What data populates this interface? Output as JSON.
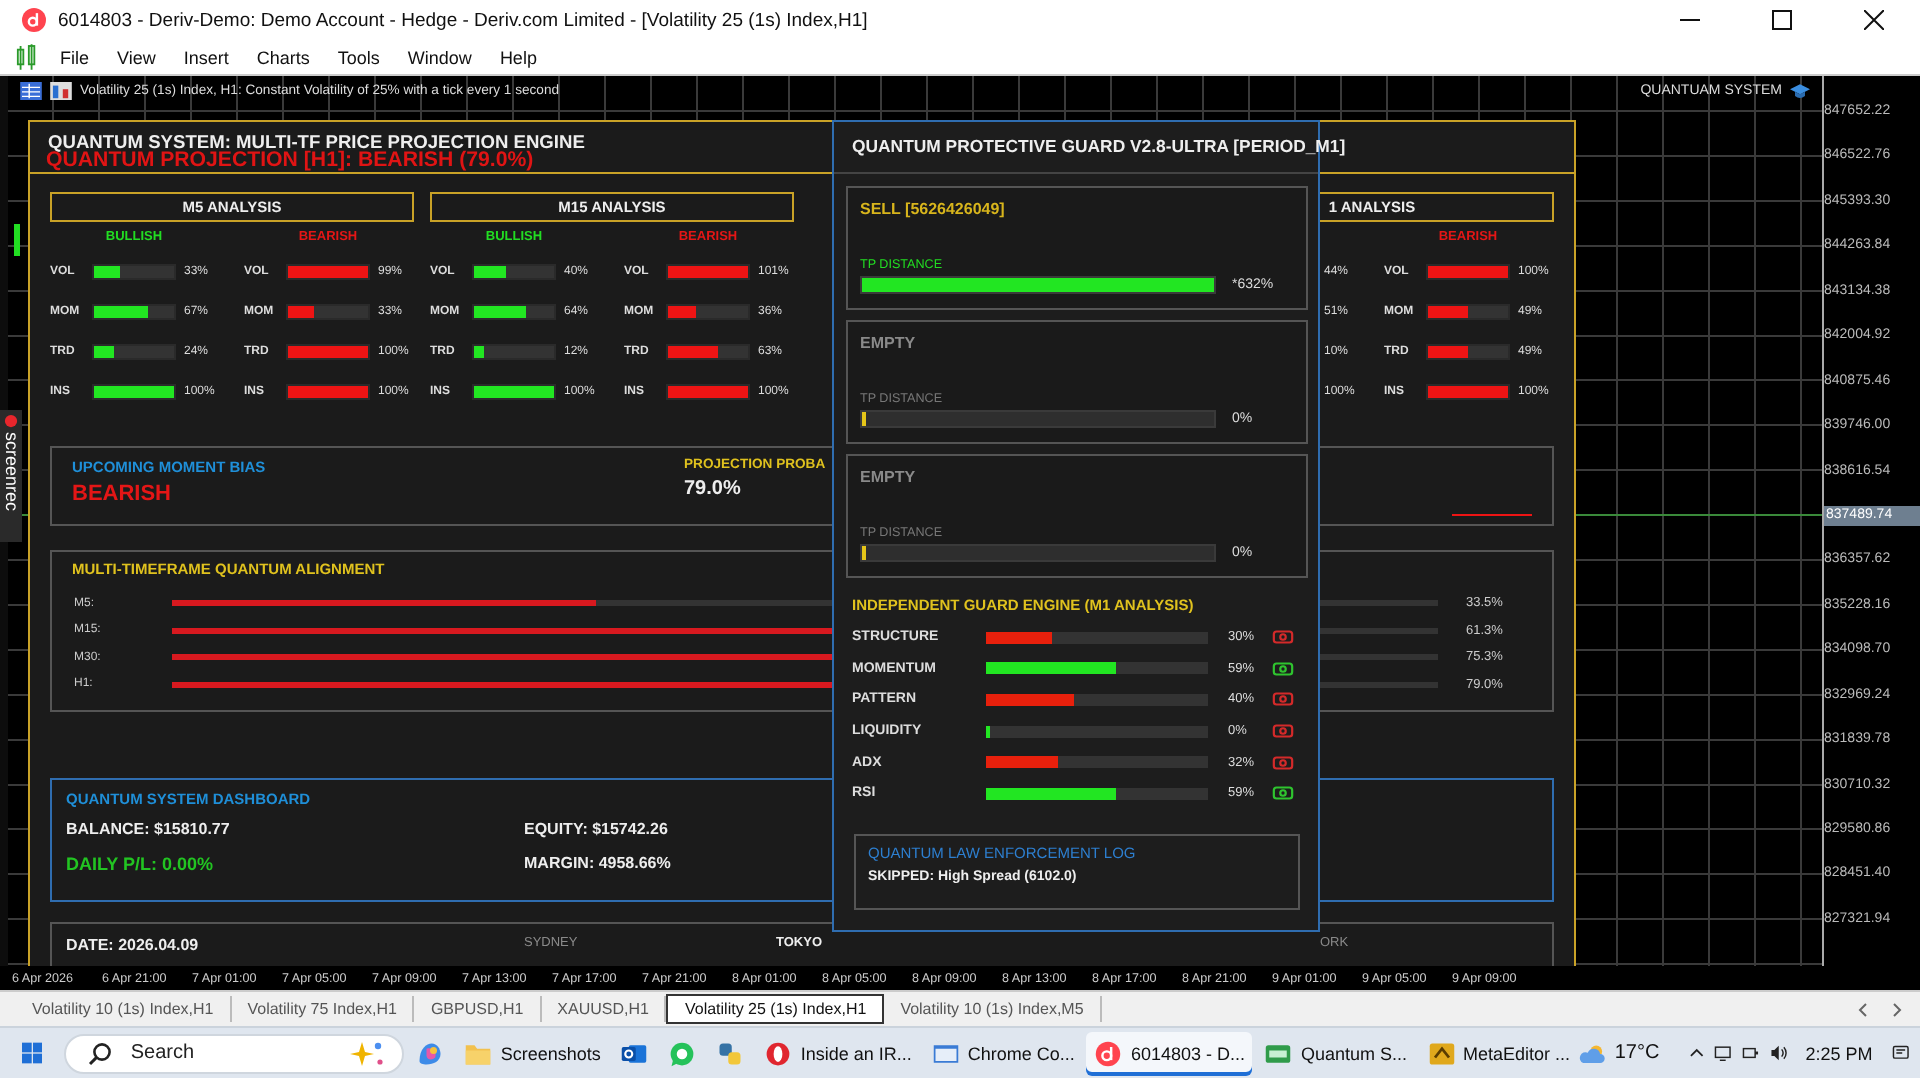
{
  "window": {
    "title": "6014803 - Deriv-Demo: Demo Account - Hedge - Deriv.com Limited - [Volatility 25 (1s) Index,H1]"
  },
  "menu": [
    "File",
    "View",
    "Insert",
    "Charts",
    "Tools",
    "Window",
    "Help"
  ],
  "chart": {
    "info": "Volatility 25 (1s) Index, H1: Constant Volatility of 25% with a tick every 1 second",
    "indicator_label": "QUANTUAM SYSTEM",
    "recorder_label": "screenrec",
    "prices": [
      {
        "value": "847652.22",
        "kind": "tick"
      },
      {
        "value": "846522.76",
        "kind": "tick"
      },
      {
        "value": "845393.30",
        "kind": "tick"
      },
      {
        "value": "844263.84",
        "kind": "tick"
      },
      {
        "value": "843134.38",
        "kind": "tick"
      },
      {
        "value": "842004.92",
        "kind": "tick"
      },
      {
        "value": "840875.46",
        "kind": "tick"
      },
      {
        "value": "839746.00",
        "kind": "tick"
      },
      {
        "value": "838616.54",
        "kind": "tick"
      },
      {
        "value": "837489.74",
        "kind": "current"
      },
      {
        "value": "836357.62",
        "kind": "tick"
      },
      {
        "value": "835228.16",
        "kind": "tick"
      },
      {
        "value": "834098.70",
        "kind": "tick"
      },
      {
        "value": "832969.24",
        "kind": "tick"
      },
      {
        "value": "831839.78",
        "kind": "tick"
      },
      {
        "value": "830710.32",
        "kind": "tick"
      },
      {
        "value": "829580.86",
        "kind": "tick"
      },
      {
        "value": "828451.40",
        "kind": "tick"
      },
      {
        "value": "827321.94",
        "kind": "tick"
      }
    ],
    "times": [
      "6 Apr 2026",
      "6 Apr 21:00",
      "7 Apr 01:00",
      "7 Apr 05:00",
      "7 Apr 09:00",
      "7 Apr 13:00",
      "7 Apr 17:00",
      "7 Apr 21:00",
      "8 Apr 01:00",
      "8 Apr 05:00",
      "8 Apr 09:00",
      "8 Apr 13:00",
      "8 Apr 17:00",
      "8 Apr 21:00",
      "9 Apr 01:00",
      "9 Apr 05:00",
      "9 Apr 09:00"
    ]
  },
  "engine_panel": {
    "title": "QUANTUM SYSTEM: MULTI-TF PRICE PROJECTION ENGINE",
    "headline": "QUANTUM PROJECTION [H1]: BEARISH (79.0%)",
    "groups": [
      {
        "header": "M5 ANALYSIS",
        "columns": [
          {
            "label": "BULLISH",
            "bullish": true,
            "rows": [
              {
                "name": "VOL",
                "level": 0.33,
                "reading": "33%"
              },
              {
                "name": "MOM",
                "level": 0.67,
                "reading": "67%"
              },
              {
                "name": "TRD",
                "level": 0.24,
                "reading": "24%"
              },
              {
                "name": "INS",
                "level": 1,
                "reading": "100%"
              }
            ]
          },
          {
            "label": "BEARISH",
            "bullish": false,
            "rows": [
              {
                "name": "VOL",
                "level": 0.99,
                "reading": "99%"
              },
              {
                "name": "MOM",
                "level": 0.33,
                "reading": "33%"
              },
              {
                "name": "TRD",
                "level": 1,
                "reading": "100%"
              },
              {
                "name": "INS",
                "level": 1,
                "reading": "100%"
              }
            ]
          }
        ]
      },
      {
        "header": "M15 ANALYSIS",
        "columns": [
          {
            "label": "BULLISH",
            "bullish": true,
            "rows": [
              {
                "name": "VOL",
                "level": 0.4,
                "reading": "40%"
              },
              {
                "name": "MOM",
                "level": 0.64,
                "reading": "64%"
              },
              {
                "name": "TRD",
                "level": 0.12,
                "reading": "12%"
              },
              {
                "name": "INS",
                "level": 1,
                "reading": "100%"
              }
            ]
          },
          {
            "label": "BEARISH",
            "bullish": false,
            "rows": [
              {
                "name": "VOL",
                "level": 1,
                "reading": "101%"
              },
              {
                "name": "MOM",
                "level": 0.36,
                "reading": "36%"
              },
              {
                "name": "TRD",
                "level": 0.63,
                "reading": "63%"
              },
              {
                "name": "INS",
                "level": 1,
                "reading": "100%"
              }
            ]
          }
        ]
      },
      {
        "header": "1 ANALYSIS",
        "columns": [
          {
            "rows": [
              {
                "reading": "44%"
              },
              {
                "reading": "51%"
              },
              {
                "reading": "10%"
              },
              {
                "reading": "100%"
              }
            ]
          },
          {
            "label": "BEARISH",
            "bullish": false,
            "rows": [
              {
                "name": "VOL",
                "level": 1,
                "reading": "100%"
              },
              {
                "name": "MOM",
                "level": 0.49,
                "reading": "49%"
              },
              {
                "name": "TRD",
                "level": 0.49,
                "reading": "49%"
              },
              {
                "name": "INS",
                "level": 1,
                "reading": "100%"
              }
            ]
          }
        ]
      }
    ],
    "bias": {
      "title": "UPCOMING MOMENT BIAS",
      "value": "BEARISH",
      "bullish": false,
      "probability_title": "PROJECTION PROBA",
      "probability": "79.0%"
    },
    "alignment": {
      "title": "MULTI-TIMEFRAME QUANTUM ALIGNMENT",
      "rows": [
        {
          "label": "M5:",
          "level": 0.335,
          "reading": "33.5%"
        },
        {
          "label": "M15:",
          "level": 0.613,
          "reading": "61.3%"
        },
        {
          "label": "M30:",
          "level": 0.753,
          "reading": "75.3%"
        },
        {
          "label": "H1:",
          "level": 0.79,
          "reading": "79.0%"
        }
      ]
    },
    "dashboard": {
      "title": "QUANTUM SYSTEM DASHBOARD",
      "balance": "BALANCE: $15810.77",
      "equity": "EQUITY: $15742.26",
      "daily_pl": "DAILY P/L: 0.00%",
      "margin": "MARGIN: 4958.66%"
    },
    "sessions": {
      "date": "DATE: 2026.04.09",
      "zones": [
        {
          "name": "SYDNEY",
          "active": false
        },
        {
          "name": "TOKYO",
          "active": true
        },
        {
          "name": "ORK",
          "active": false
        }
      ]
    }
  },
  "guard_panel": {
    "title": "QUANTUM PROTECTIVE GUARD V2.8-ULTRA [PERIOD_M1]",
    "slots": [
      {
        "kind": "trade",
        "title": "SELL [5626426049]",
        "label": "TP DISTANCE",
        "level": 1,
        "reading": "*632%"
      },
      {
        "kind": "empty",
        "title": "EMPTY",
        "label": "TP DISTANCE",
        "level": 0,
        "reading": "0%"
      },
      {
        "kind": "empty",
        "title": "EMPTY",
        "label": "TP DISTANCE",
        "level": 0,
        "reading": "0%"
      }
    ],
    "engine_title": "INDEPENDENT GUARD ENGINE (M1 ANALYSIS)",
    "engine_rows": [
      {
        "name": "STRUCTURE",
        "level": 0.3,
        "reading": "30%",
        "color": "#e8200c",
        "positive": false
      },
      {
        "name": "MOMENTUM",
        "level": 0.59,
        "reading": "59%",
        "color": "#22e622",
        "positive": true
      },
      {
        "name": "PATTERN",
        "level": 0.4,
        "reading": "40%",
        "color": "#e8200c",
        "positive": false
      },
      {
        "name": "LIQUIDITY",
        "level": 0,
        "reading": "0%",
        "color": "#22e622",
        "positive": false
      },
      {
        "name": "ADX",
        "level": 0.32,
        "reading": "32%",
        "color": "#e8200c",
        "positive": false
      },
      {
        "name": "RSI",
        "level": 0.59,
        "reading": "59%",
        "color": "#22e622",
        "positive": true
      }
    ],
    "log_title": "QUANTUM LAW ENFORCEMENT LOG",
    "log_entry": "SKIPPED: High Spread (6102.0)"
  },
  "tabs": [
    {
      "label": "Volatility 10 (1s) Index,H1",
      "selected": false
    },
    {
      "label": "Volatility 75 Index,H1",
      "selected": false
    },
    {
      "label": "GBPUSD,H1",
      "selected": false
    },
    {
      "label": "XAUUSD,H1",
      "selected": false
    },
    {
      "label": "Volatility 25 (1s) Index,H1",
      "selected": true
    },
    {
      "label": "Volatility 10 (1s) Index,M5",
      "selected": false
    }
  ],
  "taskbar": {
    "search": {
      "placeholder": "Search"
    },
    "items": [
      {
        "kind": "copilot",
        "selected": false
      },
      {
        "kind": "folder",
        "label": "Screenshots",
        "selected": false
      },
      {
        "kind": "mail",
        "selected": false
      },
      {
        "kind": "chat",
        "selected": false
      },
      {
        "kind": "python",
        "selected": false
      },
      {
        "kind": "opera",
        "label": "Inside an IR...",
        "selected": false
      },
      {
        "kind": "window",
        "label": "Chrome Co...",
        "selected": false
      },
      {
        "kind": "deriv",
        "label": "6014803 - D...",
        "selected": true
      },
      {
        "kind": "terminal",
        "label": "Quantum S...",
        "selected": false
      },
      {
        "kind": "editor",
        "label": "MetaEditor ...",
        "selected": false
      }
    ],
    "weather": "17°C",
    "time": "2:25 PM"
  }
}
